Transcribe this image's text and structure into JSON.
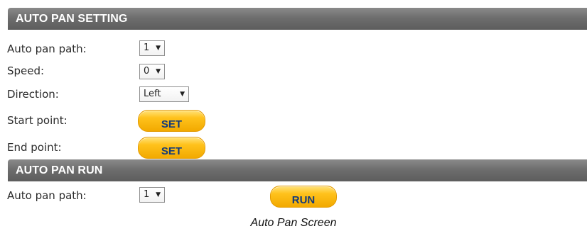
{
  "settings_section": {
    "title": "AUTO PAN SETTING",
    "path_label": "Auto pan path:",
    "path_value": "1",
    "speed_label": "Speed:",
    "speed_value": "0",
    "direction_label": "Direction:",
    "direction_value": "Left",
    "start_label": "Start point:",
    "start_button": "SET",
    "end_label": "End point:",
    "end_button": "SET"
  },
  "run_section": {
    "title": "AUTO PAN RUN",
    "path_label": "Auto pan path:",
    "path_value": "1",
    "run_button": "RUN"
  },
  "caption": "Auto Pan Screen",
  "icons": {
    "dropdown": "chevron-down-icon"
  },
  "colors": {
    "header_bg": "#6e6e6e",
    "button_fill": "#ffc21c",
    "button_text": "#123a7a"
  }
}
